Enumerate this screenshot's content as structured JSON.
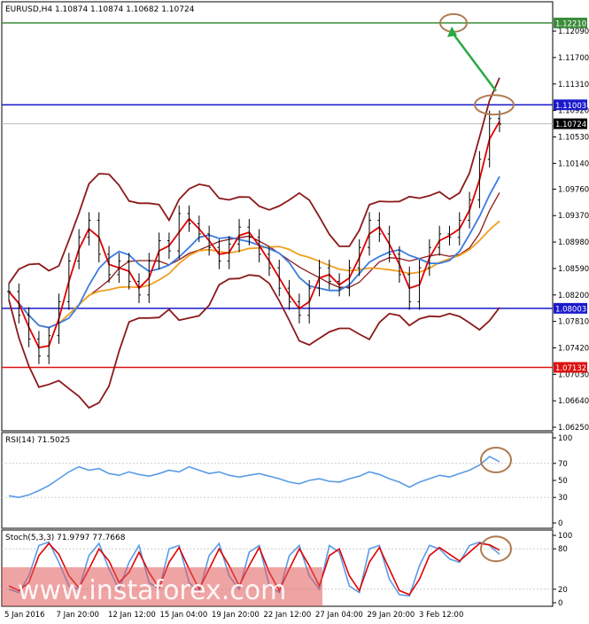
{
  "header": {
    "symbol_line": "EURUSD,H4  1.10874 1.10874 1.10682 1.10724"
  },
  "indicators": {
    "rsi_label": "RSI(14) 71.5025",
    "stoch_label": "Stoch(5,3,3) 71.9797 77.7668"
  },
  "watermark": "www.instaforex.com",
  "colors": {
    "resistance_top": "#3a8c3a",
    "resistance_mid": "#1a1acc",
    "support_mid": "#1a1acc",
    "support_low": "#dd1111",
    "bollinger": "#8b1a1a",
    "price": "#000000",
    "fast_ma": "#e00000",
    "mid_ma": "#3a7be0",
    "slow_ma": "#f0a020",
    "rsi": "#5a9be8",
    "stoch_main": "#5a9be8",
    "stoch_signal": "#e00000",
    "arrow": "#2aaa44",
    "circle": "#b07a50"
  },
  "chart_data": [
    {
      "type": "line",
      "title": "EURUSD,H4",
      "y_ticks": [
        "1.12090",
        "1.11700",
        "1.11310",
        "1.10920",
        "1.10530",
        "1.10140",
        "1.09760",
        "1.09370",
        "1.08980",
        "1.08590",
        "1.08200",
        "1.07810",
        "1.07420",
        "1.07030",
        "1.06640",
        "1.06250"
      ],
      "ylim": [
        1.0625,
        1.1247
      ],
      "x_ticks": [
        "5 Jan 2016",
        "7 Jan 20:00",
        "12 Jan 12:00",
        "15 Jan 04:00",
        "19 Jan 20:00",
        "22 Jan 12:00",
        "27 Jan 04:00",
        "29 Jan 20:00",
        "3 Feb 12:00"
      ],
      "levels": [
        {
          "value": "1.12210",
          "role": "resistance_top"
        },
        {
          "value": "1.11003",
          "role": "resistance_mid"
        },
        {
          "value": "1.10724",
          "role": "current_price"
        },
        {
          "value": "1.08003",
          "role": "support_mid"
        },
        {
          "value": "1.07132",
          "role": "support_low"
        }
      ],
      "series": [
        {
          "values": [
            1.0825,
            1.079,
            1.0755,
            1.073,
            1.076,
            1.081,
            1.087,
            1.0905,
            1.093,
            1.088,
            1.085,
            1.087,
            1.084,
            1.082,
            1.087,
            1.09,
            1.0885,
            1.094,
            1.0925,
            1.091,
            1.089,
            1.087,
            1.0895,
            1.092,
            1.0905,
            1.088,
            1.086,
            1.083,
            1.081,
            1.079,
            1.083,
            1.086,
            1.084,
            1.083,
            1.086,
            1.089,
            1.093,
            1.091,
            1.088,
            1.085,
            1.081,
            1.086,
            1.089,
            1.091,
            1.0905,
            1.093,
            1.096,
            1.102,
            1.108,
            1.1072
          ]
        }
      ]
    },
    {
      "type": "line",
      "title": "RSI(14) 71.5025",
      "y_ticks": [
        "100",
        "70",
        "50",
        "30",
        "0"
      ],
      "ylim": [
        0,
        100
      ],
      "series": [
        {
          "values": [
            32,
            30,
            33,
            38,
            44,
            52,
            60,
            66,
            62,
            64,
            58,
            56,
            60,
            57,
            55,
            58,
            62,
            60,
            66,
            62,
            58,
            60,
            56,
            54,
            56,
            58,
            55,
            52,
            48,
            46,
            50,
            52,
            49,
            48,
            52,
            55,
            60,
            57,
            52,
            48,
            42,
            48,
            52,
            56,
            54,
            58,
            62,
            68,
            78,
            72
          ]
        }
      ]
    },
    {
      "type": "line",
      "title": "Stoch(5,3,3) 71.9797 77.7668",
      "y_ticks": [
        "100",
        "80",
        "20",
        "0"
      ],
      "ylim": [
        0,
        100
      ],
      "series": [
        {
          "values": [
            20,
            15,
            40,
            85,
            90,
            60,
            25,
            20,
            70,
            88,
            50,
            20,
            60,
            85,
            30,
            20,
            80,
            85,
            30,
            15,
            70,
            88,
            40,
            20,
            75,
            85,
            25,
            15,
            70,
            85,
            40,
            20,
            85,
            75,
            25,
            15,
            80,
            85,
            35,
            12,
            10,
            55,
            85,
            80,
            65,
            60,
            85,
            90,
            85,
            72
          ]
        },
        {
          "values": [
            25,
            18,
            30,
            70,
            88,
            72,
            40,
            22,
            50,
            80,
            62,
            30,
            45,
            75,
            45,
            22,
            60,
            82,
            50,
            20,
            50,
            80,
            55,
            25,
            55,
            82,
            45,
            18,
            50,
            80,
            55,
            25,
            70,
            80,
            40,
            18,
            60,
            82,
            50,
            18,
            12,
            35,
            70,
            82,
            72,
            62,
            75,
            88,
            86,
            78
          ]
        }
      ]
    }
  ]
}
